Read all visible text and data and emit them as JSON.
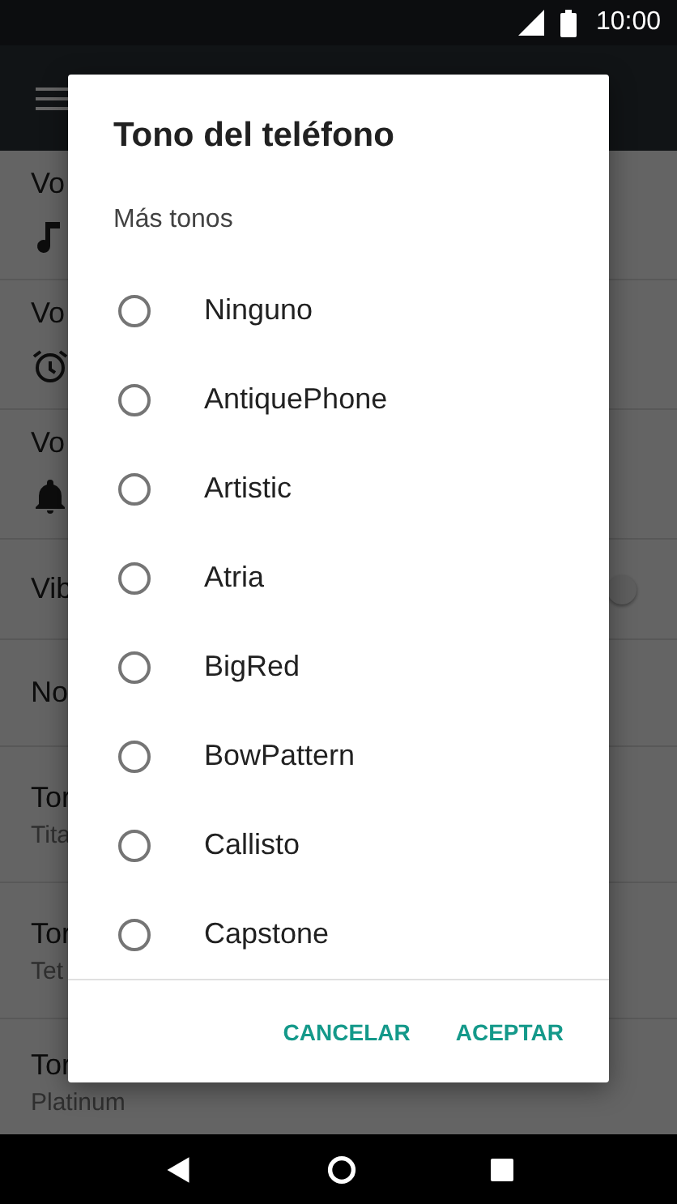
{
  "status_bar": {
    "time": "10:00"
  },
  "background": {
    "rows": [
      {
        "kind": "volume",
        "title": "Vo"
      },
      {
        "kind": "volume",
        "title": "Vo"
      },
      {
        "kind": "volume",
        "title": "Vo"
      },
      {
        "kind": "switch",
        "title": "Vib",
        "on": false
      },
      {
        "kind": "plain",
        "title": "No"
      },
      {
        "kind": "detail",
        "title": "Tor",
        "subtitle": "Tita"
      },
      {
        "kind": "detail",
        "title": "Tor",
        "subtitle": "Tet"
      },
      {
        "kind": "detail",
        "title": "Tor",
        "subtitle": "Platinum"
      }
    ]
  },
  "dialog": {
    "title": "Tono del teléfono",
    "section_label": "Más tonos",
    "options": [
      {
        "label": "Ninguno",
        "selected": false
      },
      {
        "label": "AntiquePhone",
        "selected": false
      },
      {
        "label": "Artistic",
        "selected": false
      },
      {
        "label": "Atria",
        "selected": false
      },
      {
        "label": "BigRed",
        "selected": false
      },
      {
        "label": "BowPattern",
        "selected": false
      },
      {
        "label": "Callisto",
        "selected": false
      },
      {
        "label": "Capstone",
        "selected": false
      }
    ],
    "buttons": [
      "CANCELAR",
      "ACEPTAR"
    ]
  }
}
